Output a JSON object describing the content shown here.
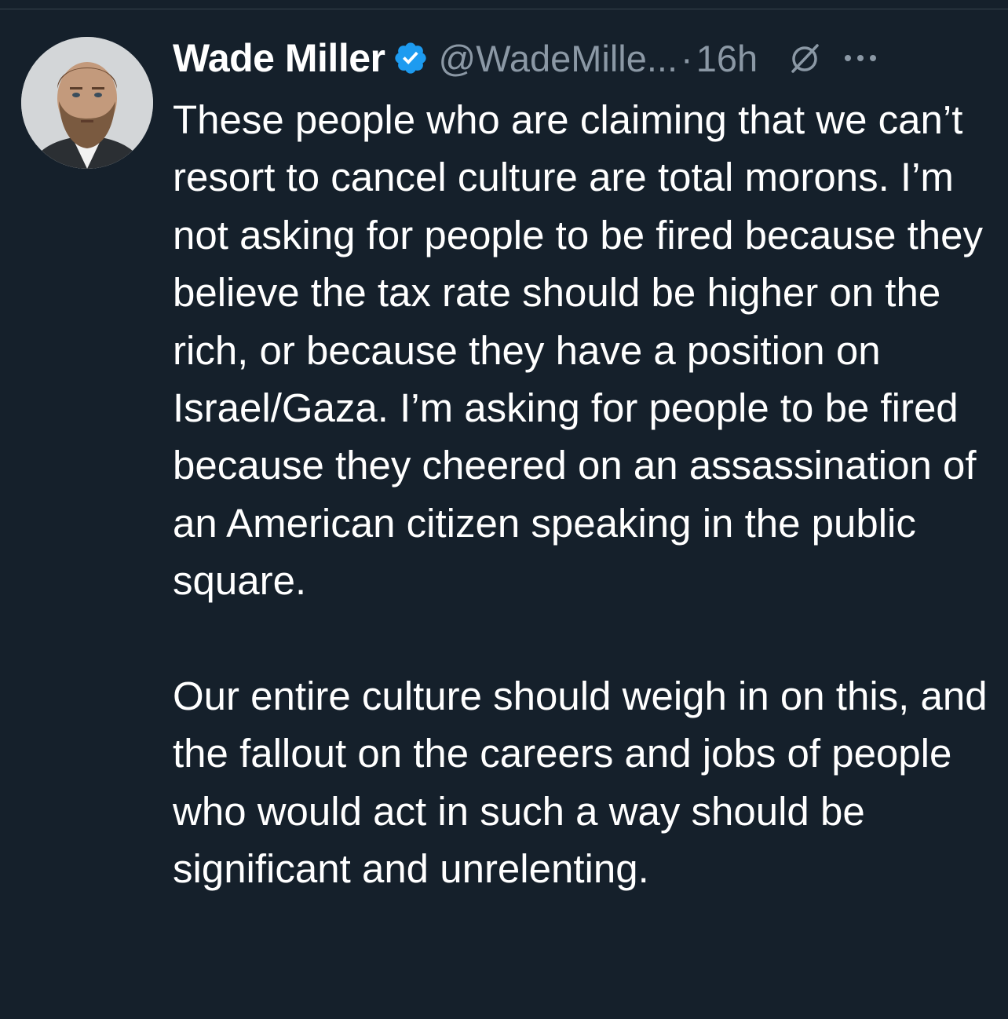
{
  "tweet": {
    "author": {
      "display_name": "Wade Miller",
      "handle": "@WadeMille...",
      "verified": true,
      "avatar_icon": "avatar-portrait"
    },
    "separator": "·",
    "timestamp": "16h",
    "paragraphs": [
      "These people who are claiming that we can’t resort to cancel culture are total morons.  I’m not asking for people to be fired because they believe the tax rate should be higher on the rich, or because they have a position on Israel/Gaza.  I’m asking for people to be fired because they cheered on an assassination of an American citizen speaking in the public square.",
      "Our entire culture should weigh in on this, and the fallout on the careers and jobs of people who would act in such a way should be significant and unrelenting."
    ]
  },
  "colors": {
    "background": "#15202b",
    "text_primary": "#ffffff",
    "text_secondary": "#8b98a5",
    "verified_blue": "#1d9bf0",
    "divider": "#38444d"
  },
  "icons": {
    "verified": "verified-badge-icon",
    "grok": "grok-icon",
    "more": "more-options-icon"
  }
}
